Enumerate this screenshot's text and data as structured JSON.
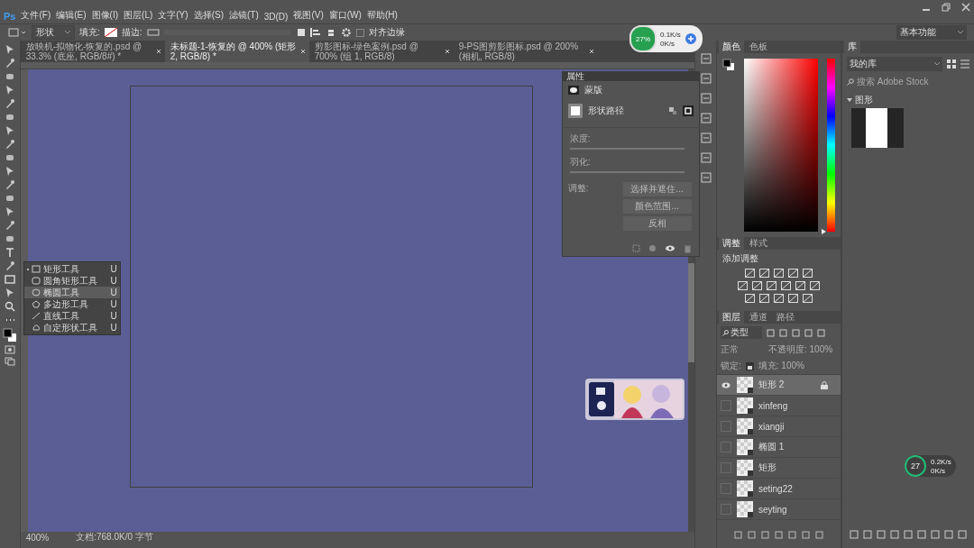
{
  "app_logo": "Ps",
  "menu": [
    "文件(F)",
    "编辑(E)",
    "图像(I)",
    "图层(L)",
    "文字(Y)",
    "选择(S)",
    "滤镜(T)",
    "3D(D)",
    "视图(V)",
    "窗口(W)",
    "帮助(H)"
  ],
  "options": {
    "mode": "形状",
    "fill_label": "填充:",
    "stroke_label": "描边:",
    "align_edges": {
      "label": "对齐边缘",
      "checked": false
    },
    "workspace": "基本功能"
  },
  "tabs": [
    {
      "label": "放映机-拟物化-恢复的.psd @ 33.3% (底座, RGB/8#) *",
      "selected": false
    },
    {
      "label": "未标题-1-恢复的 @ 400% (矩形 2, RGB/8) *",
      "selected": true
    },
    {
      "label": "剪影图标-绿色案例.psd @ 700% (组 1, RGB/8)",
      "selected": false
    },
    {
      "label": "9-PS图剪影图标.psd @ 200% (相机, RGB/8)",
      "selected": false
    }
  ],
  "tool_flyout": [
    {
      "label": "矩形工具",
      "shortcut": "U",
      "selected": true,
      "hovered": false
    },
    {
      "label": "圆角矩形工具",
      "shortcut": "U",
      "selected": false,
      "hovered": false
    },
    {
      "label": "椭圆工具",
      "shortcut": "U",
      "selected": false,
      "hovered": true
    },
    {
      "label": "多边形工具",
      "shortcut": "U",
      "selected": false,
      "hovered": false
    },
    {
      "label": "直线工具",
      "shortcut": "U",
      "selected": false,
      "hovered": false
    },
    {
      "label": "自定形状工具",
      "shortcut": "U",
      "selected": false,
      "hovered": false
    }
  ],
  "properties": {
    "title": "属性",
    "section": "蒙版",
    "path_label": "形状路径",
    "density": "浓度:",
    "feather": "羽化:",
    "adjust": "调整:",
    "buttons": [
      "选择并遮住...",
      "颜色范围...",
      "反相"
    ]
  },
  "net_widget": {
    "percent": "27%",
    "up": "0.1K/s",
    "down": "0K/s"
  },
  "net_widget_2": {
    "percent": "27",
    "up": "0.2K/s",
    "down": "0K/s"
  },
  "status": {
    "zoom": "400%",
    "doc": "文档:768.0K/0 字节"
  },
  "color_tabs": [
    {
      "label": "颜色",
      "selected": true
    },
    {
      "label": "色板",
      "selected": false
    }
  ],
  "hue": {
    "level": 0
  },
  "library": {
    "title": "库",
    "dropdown": "我的库",
    "search_placeholder": "搜索 Adobe Stock",
    "section": "图形"
  },
  "adjust_tabs": [
    {
      "label": "调整",
      "selected": true
    },
    {
      "label": "样式",
      "selected": false
    }
  ],
  "adjust_hint": "添加调整",
  "layer_tabs": [
    {
      "label": "图层",
      "selected": true
    },
    {
      "label": "通道",
      "selected": false
    },
    {
      "label": "路径",
      "selected": false
    }
  ],
  "layer_filter": "类型",
  "blend": "正常",
  "opacity": "不透明度: 100%",
  "lock": "锁定:",
  "fill": "填充: 100%",
  "layers": [
    {
      "name": "矩形 2",
      "visible": true,
      "selected": true,
      "locked": true
    },
    {
      "name": "xinfeng",
      "visible": false,
      "selected": false,
      "locked": false
    },
    {
      "name": "xiangji",
      "visible": false,
      "selected": false,
      "locked": false
    },
    {
      "name": "椭圆 1",
      "visible": false,
      "selected": false,
      "locked": false
    },
    {
      "name": "矩形",
      "visible": false,
      "selected": false,
      "locked": false
    },
    {
      "name": "seting22",
      "visible": false,
      "selected": false,
      "locked": false
    },
    {
      "name": "seyting",
      "visible": false,
      "selected": false,
      "locked": false
    }
  ]
}
